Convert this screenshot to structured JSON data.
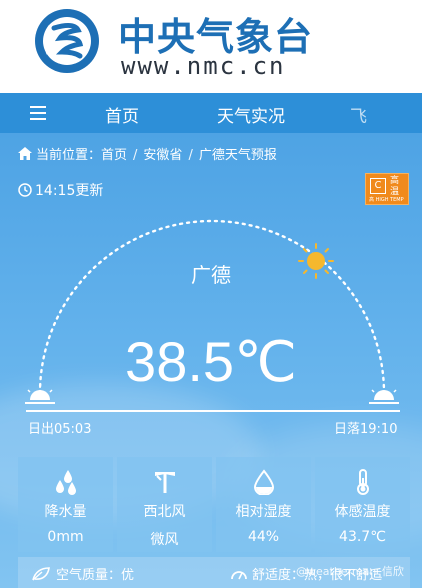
{
  "header": {
    "brand_title": "中央气象台",
    "brand_url": "www.nmc.cn",
    "logo": "nmc-swirl-logo"
  },
  "nav": {
    "menu_icon": "hamburger-icon",
    "items": [
      {
        "label": "首页"
      },
      {
        "label": "天气实况"
      },
      {
        "label": "飞"
      }
    ]
  },
  "breadcrumb": {
    "prefix": "当前位置：",
    "home": "首页",
    "province": "安徽省",
    "page": "广德天气预报",
    "separator": "/"
  },
  "weather": {
    "updated": "14:15更新",
    "city": "广德",
    "temperature": "38.5℃",
    "sunrise": "日出05:03",
    "sunset": "日落19:10",
    "alert": {
      "box": "C",
      "label": "高温",
      "sub": "高 HIGH TEMP"
    },
    "accent_color": "#f5b82e"
  },
  "stats": [
    {
      "icon": "raindrops-icon",
      "label": "降水量",
      "value": "0mm"
    },
    {
      "icon": "wind-vane-icon",
      "label": "西北风",
      "value": "微风"
    },
    {
      "icon": "humidity-drop-icon",
      "label": "相对湿度",
      "value": "44%"
    },
    {
      "icon": "thermometer-icon",
      "label": "体感温度",
      "value": "43.7℃"
    }
  ],
  "bottom": {
    "aqi": "空气质量：优",
    "comfort": "舒适度：热，很不舒适"
  },
  "watermark": "@weatherman_信欣"
}
